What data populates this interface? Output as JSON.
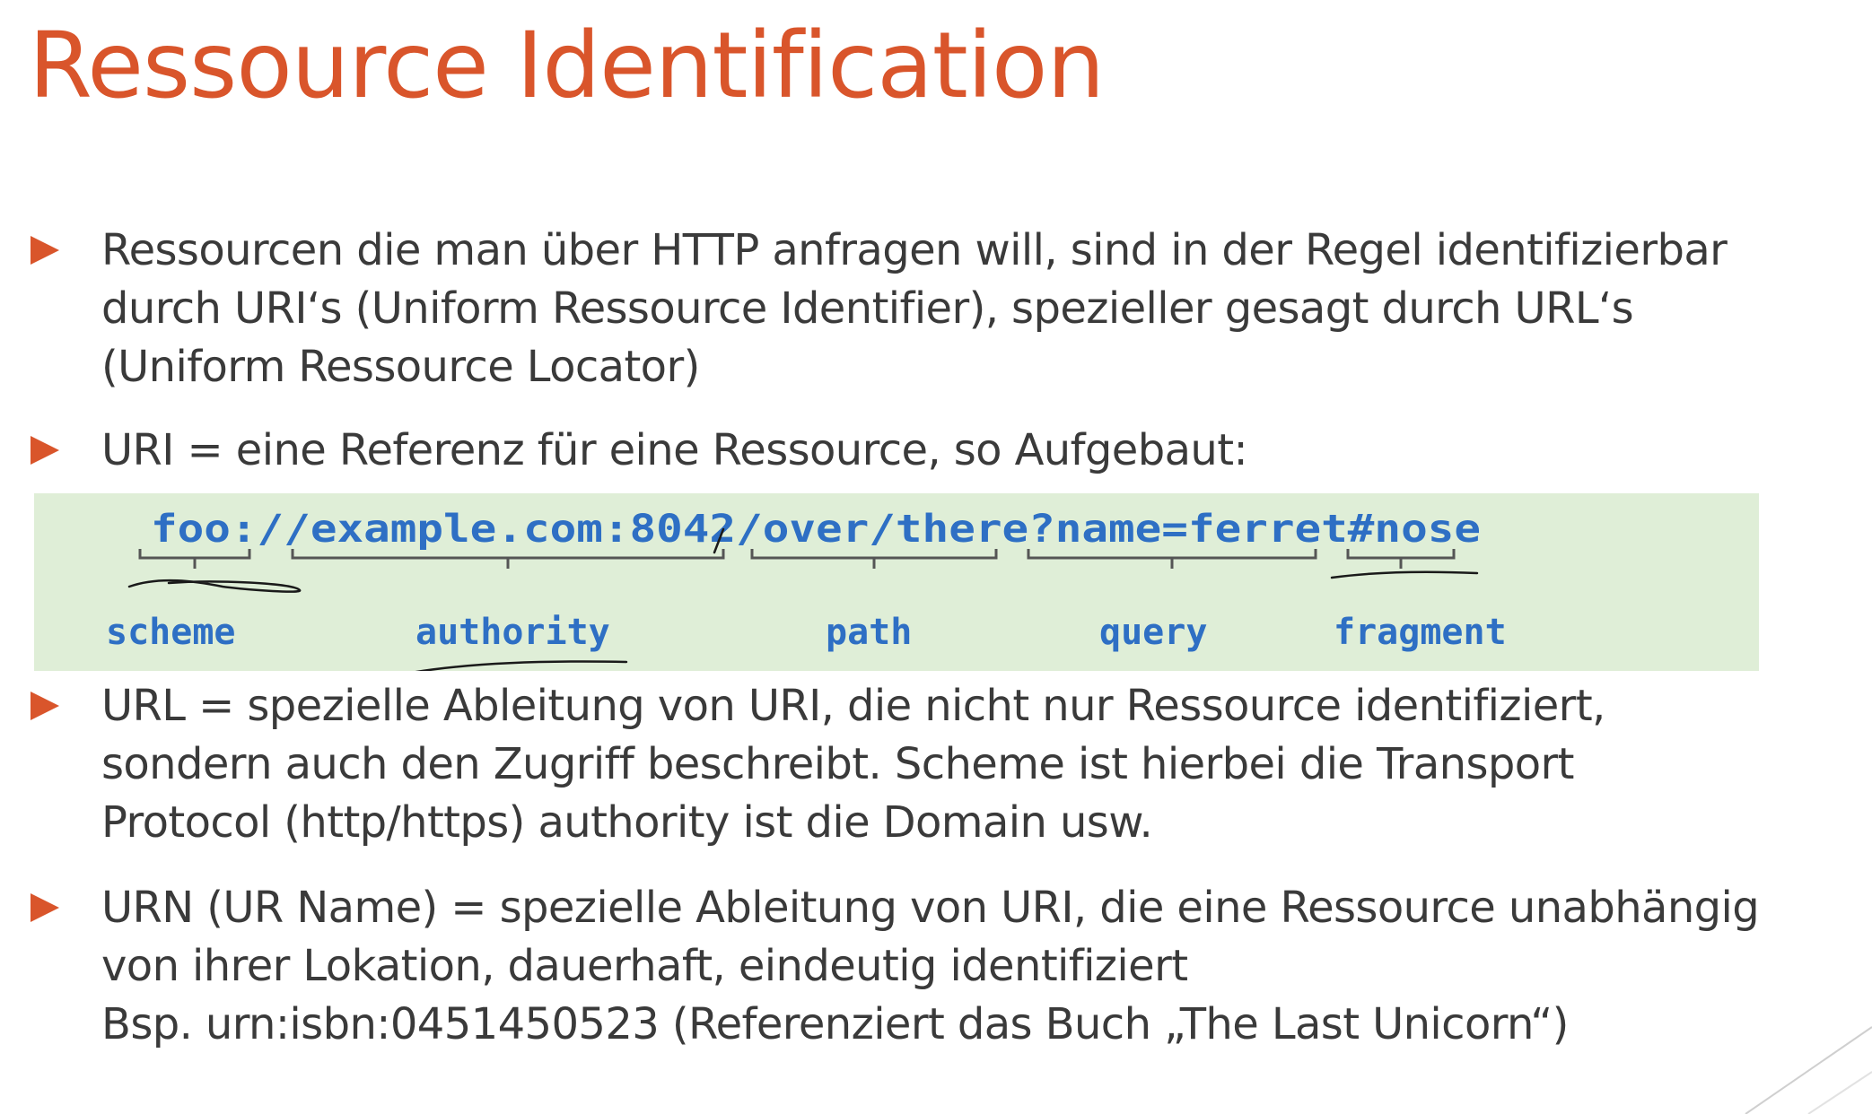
{
  "title": "Ressource Identification",
  "bullets": [
    {
      "lines": [
        "Ressourcen die man über HTTP anfragen will, sind in der Regel identifizierbar",
        "durch URI‘s (Uniform Ressource Identifier), spezieller gesagt durch URL‘s",
        "(Uniform Ressource Locator)"
      ]
    },
    {
      "lines": [
        "URI = eine Referenz für eine Ressource, so Aufgebaut:"
      ]
    },
    {
      "lines": [
        "URL = spezielle Ableitung von URI, die nicht nur Ressource identifiziert,",
        "sondern auch den Zugriff beschreibt. Scheme ist hierbei die Transport",
        "Protocol (http/https) authority ist die Domain usw."
      ]
    },
    {
      "lines": [
        "URN (UR Name) = spezielle Ableitung von URI, die eine Ressource unabhängig",
        "von ihrer Lokation, dauerhaft, eindeutig identifiziert",
        "Bsp. urn:isbn:0451450523 (Referenziert das Buch „The Last Unicorn“)"
      ]
    }
  ],
  "uri_diagram": {
    "uri_text": "foo://example.com:8042/over/there?name=ferret#nose",
    "parts": [
      {
        "label": "scheme",
        "text": "foo"
      },
      {
        "label": "authority",
        "text": "example.com:8042"
      },
      {
        "label": "path",
        "text": "/over/there"
      },
      {
        "label": "query",
        "text": "name=ferret"
      },
      {
        "label": "fragment",
        "text": "nose"
      }
    ],
    "colors": {
      "background": "#dfeed7",
      "text": "#2e6fc4",
      "bracket": "#555555",
      "annotation": "#1a1a1a"
    }
  },
  "colors": {
    "accent": "#d9552b",
    "body_text": "#3a3a3a"
  }
}
